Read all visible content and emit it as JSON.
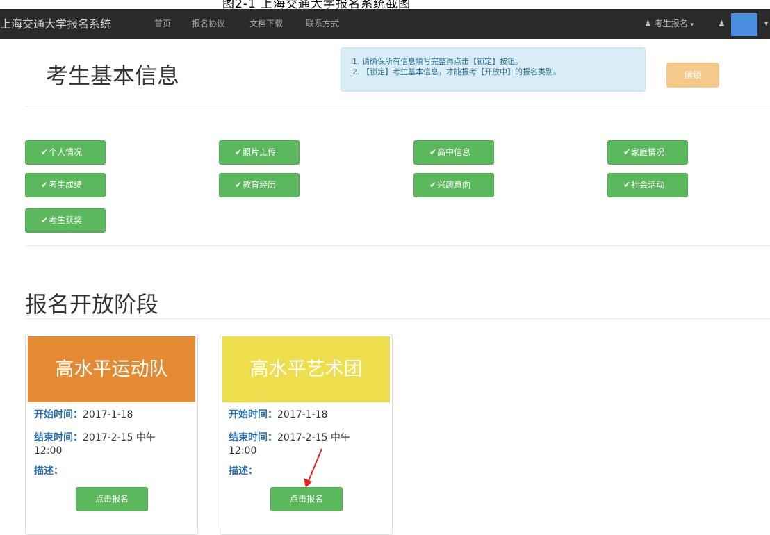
{
  "top_caption": "图2-1 上海交通大学报名系统截图",
  "navbar": {
    "brand": "上海交通大学报名系统",
    "links": [
      "首页",
      "报名协议",
      "文档下载",
      "联系方式"
    ],
    "user_menu": "考生报名",
    "account_icon": "user-icon"
  },
  "header": {
    "title": "考生基本信息",
    "alert_lines": [
      "1. 请确保所有信息填写完整再点击【锁定】按钮。",
      "2. 【锁定】考生基本信息，才能报考【开放中】的报名类别。"
    ],
    "unlock_label": "解锁"
  },
  "info_sections": [
    {
      "label": "个人情况"
    },
    {
      "label": "照片上传"
    },
    {
      "label": "高中信息"
    },
    {
      "label": "家庭情况"
    },
    {
      "label": "考生成绩"
    },
    {
      "label": "教育经历"
    },
    {
      "label": "兴趣意向"
    },
    {
      "label": "社会活动"
    },
    {
      "label": "考生获奖"
    }
  ],
  "stage_title": "报名开放阶段",
  "stages": [
    {
      "name": "高水平运动队",
      "color": "#e48a33",
      "start_label": "开始时间：",
      "start_value": "2017-1-18",
      "end_label": "结束时间：",
      "end_value_line1": "2017-2-15 中午",
      "end_value_line2": "12:00",
      "desc_label": "描述：",
      "button_label": "点击报名"
    },
    {
      "name": "高水平艺术团",
      "color": "#eedd4c",
      "start_label": "开始时间：",
      "start_value": "2017-1-18",
      "end_label": "结束时间：",
      "end_value_line1": "2017-2-15 中午",
      "end_value_line2": "12:00",
      "desc_label": "描述：",
      "button_label": "点击报名"
    }
  ],
  "colors": {
    "navbar_bg": "#2a2a2a",
    "success": "#5cb85c",
    "warning_light": "#f5c98a",
    "info_bg": "#d9edf7",
    "annotation_arrow": "#e8201d"
  }
}
